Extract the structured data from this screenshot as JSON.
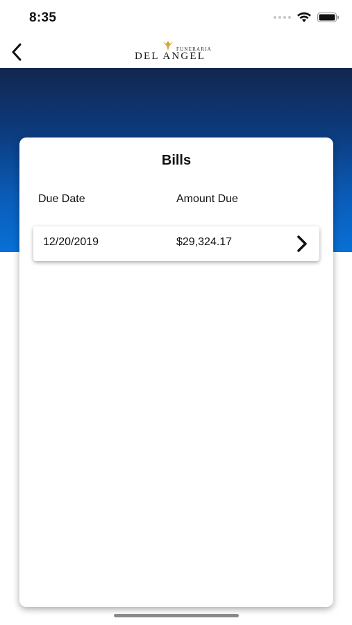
{
  "status_bar": {
    "time": "8:35",
    "wifi_icon": "wifi-icon",
    "battery_icon": "battery-icon"
  },
  "nav": {
    "back_icon": "chevron-left-icon",
    "logo": {
      "small_text": "FUNERARIA",
      "main_text": "DEL ANGEL"
    }
  },
  "colors": {
    "band_top": "#13264f",
    "band_bottom": "#0870d6"
  },
  "bills": {
    "title": "Bills",
    "columns": {
      "due_date": "Due Date",
      "amount_due": "Amount Due"
    },
    "rows": [
      {
        "due_date": "12/20/2019",
        "amount": "$29,324.17",
        "icon": "chevron-right-icon"
      }
    ]
  }
}
